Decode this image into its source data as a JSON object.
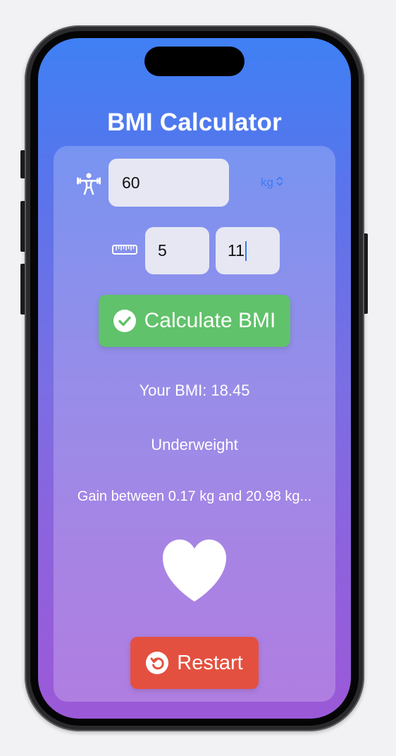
{
  "app": {
    "title": "BMI Calculator"
  },
  "weight": {
    "icon": "weightlifting-icon",
    "value": "60",
    "unit": "kg"
  },
  "height": {
    "icon": "ruler-icon",
    "feet": "5",
    "inches": "11"
  },
  "calculate": {
    "label": "Calculate BMI",
    "icon": "checkmark-circle-icon",
    "color": "#60c26a"
  },
  "result": {
    "bmi": "Your BMI: 18.45",
    "category": "Underweight",
    "advice": "Gain between 0.17 kg and 20.98 kg..."
  },
  "heart": {
    "icon": "heart-icon"
  },
  "restart": {
    "label": "Restart",
    "icon": "restart-icon",
    "color": "#e4503f"
  },
  "colors": {
    "gradient_top": "#3f80f4",
    "gradient_bottom": "#9b59d8",
    "accent": "#3b7cf5"
  }
}
